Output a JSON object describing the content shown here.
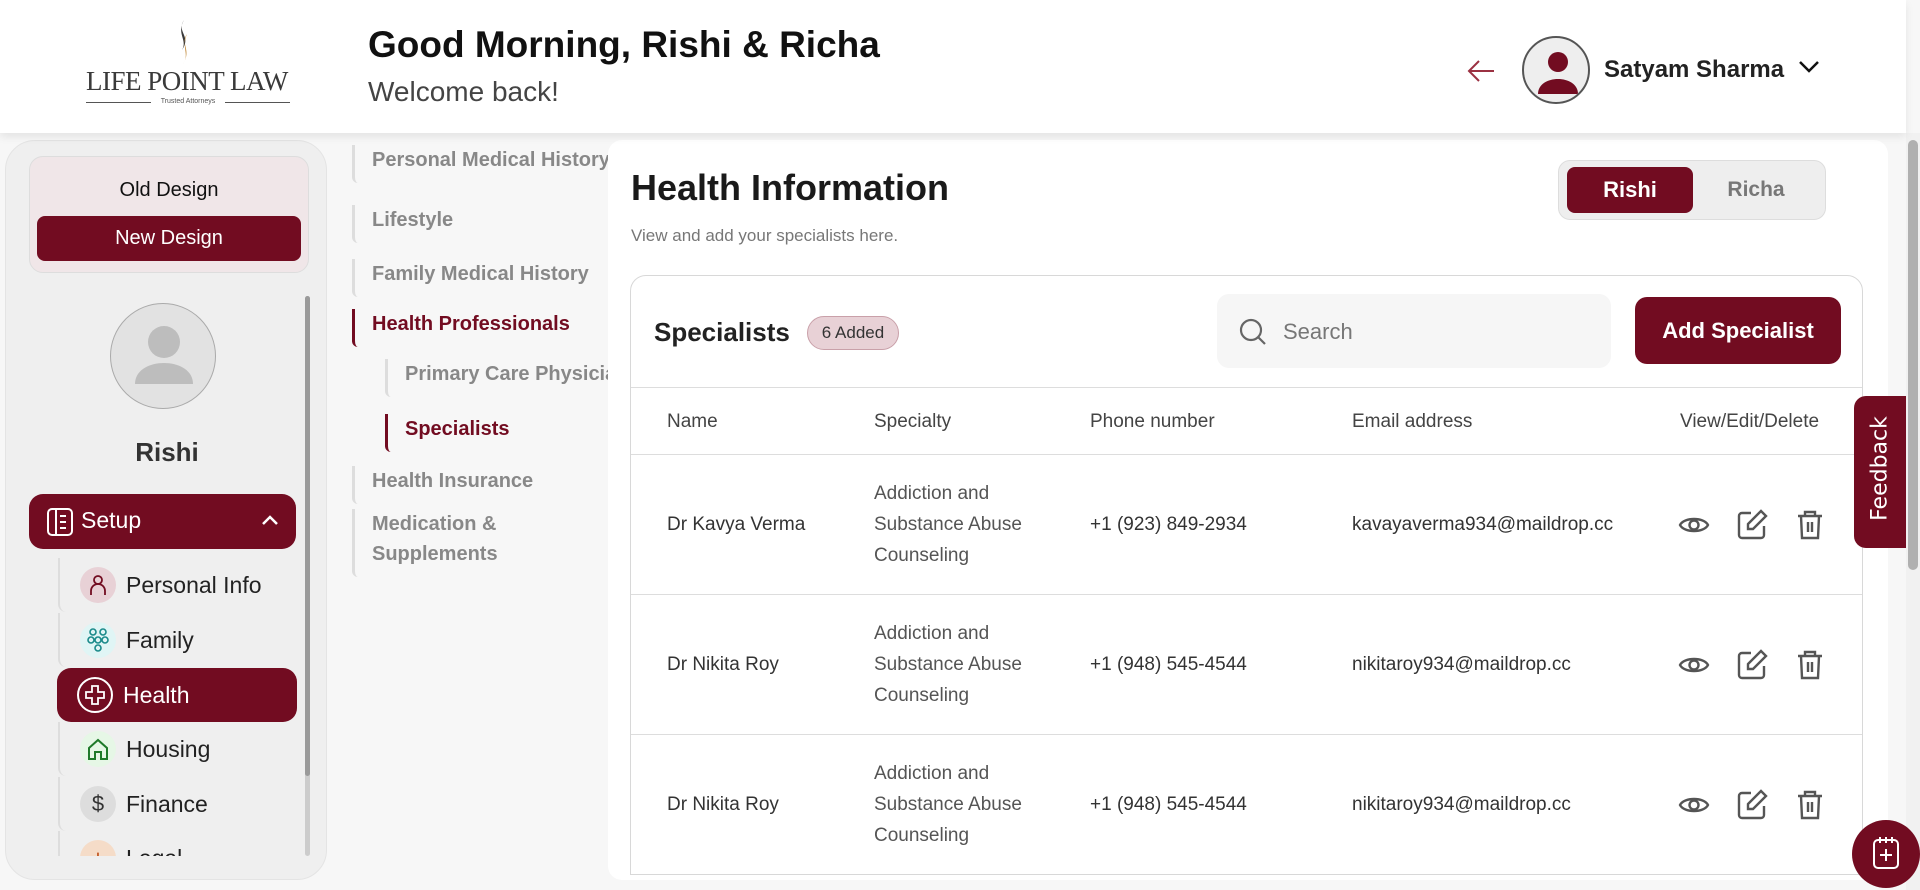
{
  "brand": {
    "name": "LIFE POINT LAW",
    "tagline": "Trusted Attorneys",
    "accent": "#720c21"
  },
  "header": {
    "greeting": "Good Morning, Rishi & Richa",
    "subtitle": "Welcome back!",
    "user_name": "Satyam Sharma"
  },
  "sidebar": {
    "design_toggle": {
      "old": "Old Design",
      "new": "New Design",
      "selected": "New Design"
    },
    "profile_name": "Rishi",
    "setup_label": "Setup",
    "items": [
      {
        "label": "Personal Info",
        "icon": "person-icon"
      },
      {
        "label": "Family",
        "icon": "family-icon"
      },
      {
        "label": "Health",
        "icon": "health-cross-icon",
        "active": true
      },
      {
        "label": "Housing",
        "icon": "house-icon"
      },
      {
        "label": "Finance",
        "icon": "dollar-icon"
      },
      {
        "label": "Legal",
        "icon": "legal-icon"
      }
    ]
  },
  "subnav": [
    {
      "label": "Personal Medical History"
    },
    {
      "label": "Lifestyle"
    },
    {
      "label": "Family Medical History"
    },
    {
      "label": "Health Professionals",
      "active": true
    },
    {
      "label": "Primary Care Physician",
      "child": true
    },
    {
      "label": "Specialists",
      "child": true,
      "active": true
    },
    {
      "label": "Health Insurance"
    },
    {
      "label": "Medication & Supplements"
    }
  ],
  "main": {
    "title": "Health Information",
    "subtitle": "View and add your specialists here.",
    "person_toggle": {
      "options": [
        "Rishi",
        "Richa"
      ],
      "selected": "Rishi"
    },
    "card": {
      "title": "Specialists",
      "badge": "6 Added",
      "search_placeholder": "Search",
      "add_button": "Add Specialist",
      "columns": [
        "Name",
        "Specialty",
        "Phone number",
        "Email address",
        "View/Edit/Delete"
      ],
      "rows": [
        {
          "name": "Dr Kavya Verma",
          "specialty": "Addiction and Substance Abuse Counseling",
          "phone": "+1 (923) 849-2934",
          "email": "kavayaverma934@maildrop.cc"
        },
        {
          "name": "Dr Nikita Roy",
          "specialty": "Addiction and Substance Abuse Counseling",
          "phone": "+1 (948) 545-4544",
          "email": "nikitaroy934@maildrop.cc"
        },
        {
          "name": "Dr Nikita Roy",
          "specialty": "Addiction and Substance Abuse Counseling",
          "phone": "+1 (948) 545-4544",
          "email": "nikitaroy934@maildrop.cc"
        }
      ]
    }
  },
  "feedback_label": "Feedback"
}
